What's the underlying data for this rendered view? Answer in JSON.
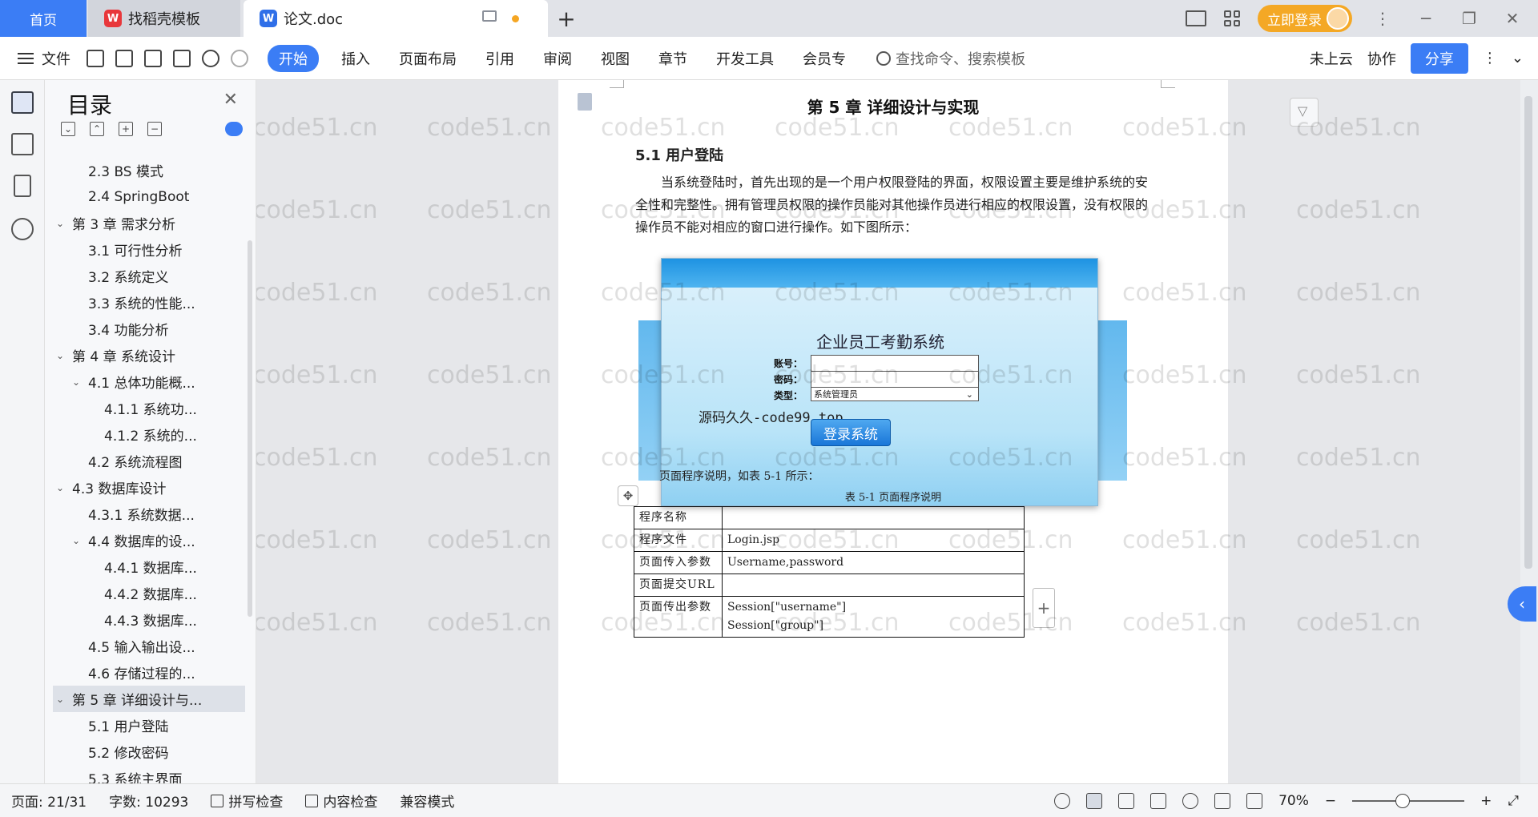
{
  "titlebar": {
    "home_tab": "首页",
    "template_tab": "找稻壳模板",
    "doc_tab": "论文.doc",
    "login_button": "立即登录"
  },
  "ribbon": {
    "file_label": "文件",
    "tabs": [
      "开始",
      "插入",
      "页面布局",
      "引用",
      "审阅",
      "视图",
      "章节",
      "开发工具",
      "会员专"
    ],
    "search_placeholder": "查找命令、搜索模板",
    "cloud_label": "未上云",
    "collab_label": "协作",
    "share_label": "分享"
  },
  "outline": {
    "title": "目录",
    "items": [
      {
        "label": "2.3 BS 模式",
        "level": 2,
        "expander": ""
      },
      {
        "label": "2.4 SpringBoot",
        "level": 2,
        "expander": ""
      },
      {
        "label": "第 3 章  需求分析",
        "level": 1,
        "expander": "v"
      },
      {
        "label": "3.1  可行性分析",
        "level": 2,
        "expander": ""
      },
      {
        "label": "3.2  系统定义",
        "level": 2,
        "expander": ""
      },
      {
        "label": "3.3  系统的性能...",
        "level": 2,
        "expander": ""
      },
      {
        "label": "3.4  功能分析",
        "level": 2,
        "expander": ""
      },
      {
        "label": "第 4 章  系统设计",
        "level": 1,
        "expander": "v"
      },
      {
        "label": "4.1  总体功能概...",
        "level": 2,
        "expander": "v"
      },
      {
        "label": "4.1.1 系统功...",
        "level": 3,
        "expander": ""
      },
      {
        "label": "4.1.2  系统的...",
        "level": 3,
        "expander": ""
      },
      {
        "label": "4.2  系统流程图",
        "level": 2,
        "expander": ""
      },
      {
        "label": "4.3 数据库设计",
        "level": 1,
        "expander": "v"
      },
      {
        "label": "4.3.1  系统数据...",
        "level": 2,
        "expander": ""
      },
      {
        "label": "4.4  数据库的设...",
        "level": 2,
        "expander": "v"
      },
      {
        "label": "4.4.1  数据库...",
        "level": 3,
        "expander": ""
      },
      {
        "label": "4.4.2  数据库...",
        "level": 3,
        "expander": ""
      },
      {
        "label": "4.4.3  数据库...",
        "level": 3,
        "expander": ""
      },
      {
        "label": "4.5  输入输出设...",
        "level": 2,
        "expander": ""
      },
      {
        "label": "4.6  存储过程的...",
        "level": 2,
        "expander": ""
      },
      {
        "label": "第 5 章  详细设计与...",
        "level": 1,
        "expander": "v",
        "selected": true
      },
      {
        "label": "5.1  用户登陆",
        "level": 2,
        "expander": ""
      },
      {
        "label": "5.2  修改密码",
        "level": 2,
        "expander": ""
      },
      {
        "label": "5.3  系统主界面",
        "level": 2,
        "expander": ""
      }
    ]
  },
  "document": {
    "chapter_title": "第 5 章  详细设计与实现",
    "section_title": "5.1  用户登陆",
    "paragraph": "当系统登陆时，首先出现的是一个用户权限登陆的界面，权限设置主要是维护系统的安全性和完整性。拥有管理员权限的操作员能对其他操作员进行相应的权限设置，没有权限的操作员不能对相应的窗口进行操作。如下图所示：",
    "login_figure": {
      "title": "企业员工考勤系统",
      "account_label": "账号：",
      "password_label": "密码：",
      "type_label": "类型：",
      "type_value": "系统管理员",
      "login_button": "登录系统",
      "overlay_text": "源码久久-code99.top"
    },
    "table_intro": "页面程序说明，如表 5-1 所示：",
    "table_caption": "表 5-1 页面程序说明",
    "table_rows": [
      {
        "key": "程序名称",
        "value": ""
      },
      {
        "key": "程序文件",
        "value": "Login.jsp"
      },
      {
        "key": "页面传入参数",
        "value": "Username,password"
      },
      {
        "key": "页面提交URL",
        "value": ""
      },
      {
        "key": "页面传出参数",
        "value": "Session[\"username\"]\nSession[\"group\"]"
      }
    ]
  },
  "watermark_text": "code51.cn",
  "statusbar": {
    "page": "页面: 21/31",
    "words": "字数: 10293",
    "spell_check": "拼写检查",
    "content_check": "内容检查",
    "compat_mode": "兼容模式",
    "zoom": "70%"
  }
}
